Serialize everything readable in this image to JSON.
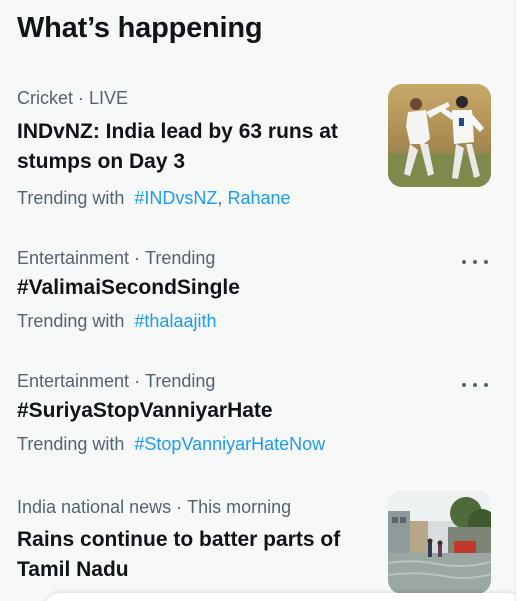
{
  "header": {
    "title": "What’s happening"
  },
  "trends": [
    {
      "category": "Cricket",
      "status": "LIVE",
      "title": "INDvNZ: India lead by 63 runs at stumps on Day 3",
      "with_label": "Trending with",
      "tags": [
        "#INDvsNZ",
        "Rahane"
      ],
      "tag_separator": ","
    },
    {
      "category": "Entertainment",
      "status": "Trending",
      "title": "#ValimaiSecondSingle",
      "with_label": "Trending with",
      "tags": [
        "#thalaajith"
      ]
    },
    {
      "category": "Entertainment",
      "status": "Trending",
      "title": "#SuriyaStopVanniyarHate",
      "with_label": "Trending with",
      "tags": [
        "#StopVanniyarHateNow"
      ]
    },
    {
      "category": "India national news",
      "status": "This morning",
      "title": "Rains continue to batter parts of Tamil Nadu"
    }
  ],
  "meta_separator": "·",
  "colors": {
    "background": "#f7f9f9",
    "text_primary": "#0f1419",
    "text_secondary": "#536471",
    "link": "#1d9bf0"
  },
  "icons": {
    "more": "more-horizontal-icon",
    "cricket_thumbnail": "cricket-players-celebrating-photo",
    "rain_thumbnail": "flooded-street-photo"
  }
}
